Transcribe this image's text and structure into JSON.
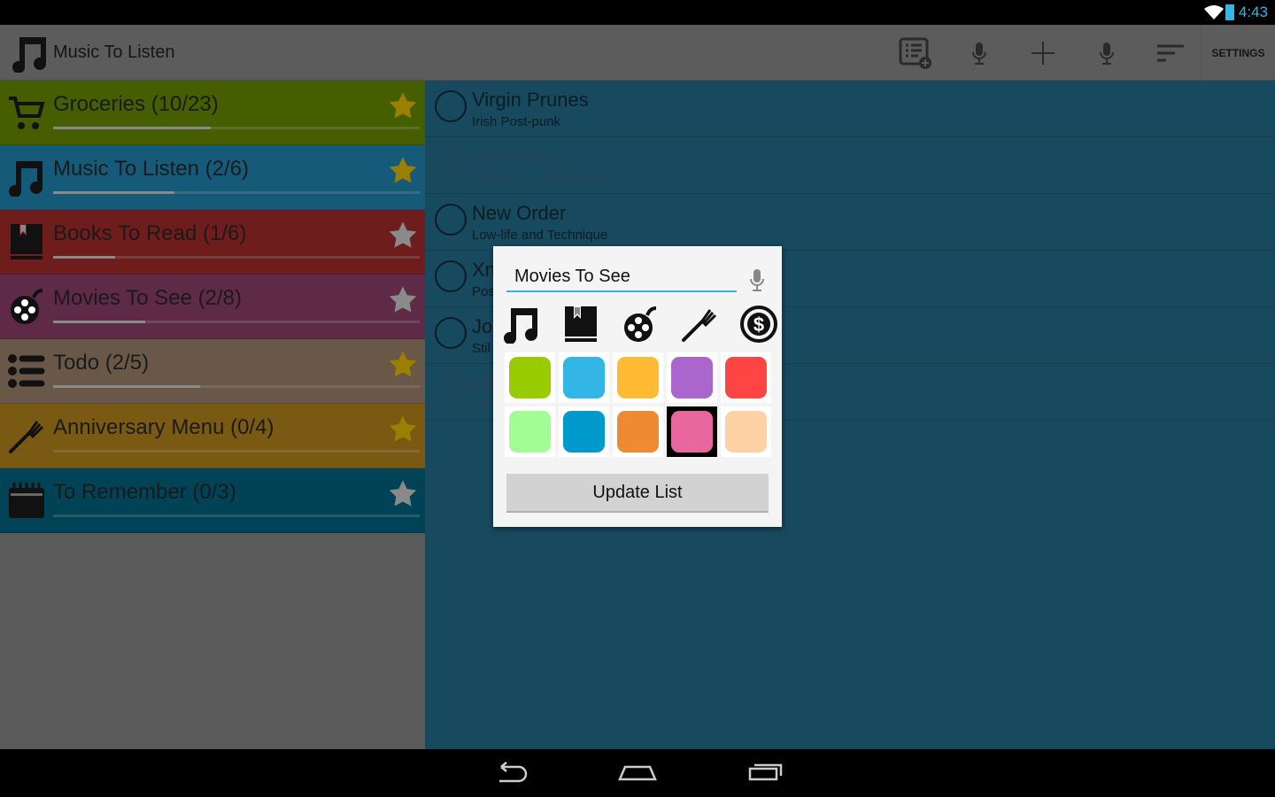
{
  "status": {
    "time": "4:43",
    "accent": "#33b5e5"
  },
  "actionbar": {
    "title": "Music To Listen",
    "settings_label": "SETTINGS",
    "icons": [
      "list-add-icon",
      "mic-icon",
      "plus-icon",
      "mic-icon",
      "sort-icon"
    ]
  },
  "lists": [
    {
      "name": "Groceries (10/23)",
      "icon": "cart-icon",
      "color": "#455f00",
      "progress": 0.43,
      "starred": true
    },
    {
      "name": "Music To Listen (2/6)",
      "icon": "music-icon",
      "color": "#155a78",
      "progress": 0.33,
      "starred": true
    },
    {
      "name": "Books To Read (1/6)",
      "icon": "book-icon",
      "color": "#6e1c1c",
      "progress": 0.17,
      "starred": false
    },
    {
      "name": "Movies To See (2/8)",
      "icon": "film-reel-icon",
      "color": "#5e2a48",
      "progress": 0.25,
      "starred": false
    },
    {
      "name": "Todo (2/5)",
      "icon": "list-icon",
      "color": "#695848",
      "progress": 0.4,
      "starred": true
    },
    {
      "name": "Anniversary Menu (0/4)",
      "icon": "fork-icon",
      "color": "#7a5a12",
      "progress": 0,
      "starred": true
    },
    {
      "name": "To Remember (0/3)",
      "icon": "calendar-icon",
      "color": "#004356",
      "progress": 0,
      "starred": false
    }
  ],
  "items": [
    {
      "title": "Virgin Prunes",
      "subtitle": "Irish Post-punk",
      "done": false
    },
    {
      "title": "Gun Club",
      "subtitle": "Jeffrey Lee Pierce band",
      "done": true
    },
    {
      "title": "New Order",
      "subtitle": "Low-life and Technique",
      "done": false
    },
    {
      "title": "Xn",
      "subtitle": "Pos",
      "done": false
    },
    {
      "title": "Jo",
      "subtitle": "Stil",
      "done": false
    },
    {
      "title": "An",
      "subtitle": "Sup",
      "done": true
    }
  ],
  "dialog": {
    "name_value": "Movies To See",
    "icons": [
      "music-icon",
      "book-icon",
      "film-reel-icon",
      "fork-icon",
      "dollar-icon"
    ],
    "colors": [
      "#99cc00",
      "#33b5e5",
      "#ffbb33",
      "#aa66cc",
      "#ff4444",
      "#a2fd95",
      "#0099cc",
      "#f08a30",
      "#e8679e",
      "#ffd2a6"
    ],
    "selected_color": "#e8679e",
    "update_label": "Update List"
  }
}
